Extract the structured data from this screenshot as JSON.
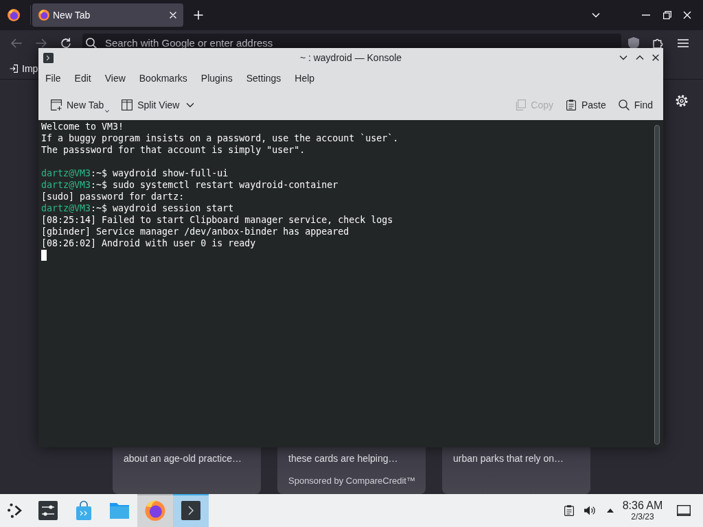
{
  "browser": {
    "tabs": [
      {
        "title": "New Tab",
        "selected": true
      }
    ],
    "nav_buttons": [
      {
        "kind": "back",
        "disabled": true
      },
      {
        "kind": "forward",
        "disabled": true
      },
      {
        "kind": "reload",
        "disabled": false
      }
    ],
    "address_bar": {
      "placeholder": "Search with Google or enter address"
    },
    "bookmarks": [
      {
        "label": "Imp"
      }
    ],
    "cards": [
      {
        "excerpt": "about an age-old practice…"
      },
      {
        "excerpt": "these cards are helping…",
        "sponsor": "Sponsored by CompareCredit™"
      },
      {
        "excerpt": "urban parks that rely on…"
      }
    ]
  },
  "konsole": {
    "title": "~ : waydroid — Konsole",
    "menu": [
      "File",
      "Edit",
      "View",
      "Bookmarks",
      "Plugins",
      "Settings",
      "Help"
    ],
    "toolbar": {
      "left": [
        {
          "kind": "new-tab",
          "label": "New Tab",
          "disabled": false,
          "dropdown": true
        },
        {
          "kind": "split-view",
          "label": "Split View",
          "disabled": false,
          "dropdown": true
        }
      ],
      "right": [
        {
          "kind": "copy",
          "label": "Copy",
          "disabled": true,
          "dropdown": false
        },
        {
          "kind": "paste",
          "label": "Paste",
          "disabled": false,
          "dropdown": false
        },
        {
          "kind": "find",
          "label": "Find",
          "disabled": false,
          "dropdown": false
        }
      ]
    },
    "lines": [
      {
        "kind": "output",
        "text": "Welcome to VM3!"
      },
      {
        "kind": "output",
        "text": "If a buggy program insists on a password, use the account `user`."
      },
      {
        "kind": "output",
        "text": "The passsword for that account is simply \"user\"."
      },
      {
        "kind": "blank"
      },
      {
        "kind": "prompt",
        "user": "dartz@VM3",
        "dir": ":~$",
        "command": "waydroid show-full-ui"
      },
      {
        "kind": "prompt",
        "user": "dartz@VM3",
        "dir": ":~$",
        "command": "sudo systemctl restart waydroid-container"
      },
      {
        "kind": "output",
        "text": "[sudo] password for dartz:"
      },
      {
        "kind": "prompt",
        "user": "dartz@VM3",
        "dir": ":~$",
        "command": "waydroid session start"
      },
      {
        "kind": "output",
        "text": "[08:25:14] Failed to start Clipboard manager service, check logs"
      },
      {
        "kind": "output",
        "text": "[gbinder] Service manager /dev/anbox-binder has appeared"
      },
      {
        "kind": "output",
        "text": "[08:26:02] Android with user 0 is ready"
      },
      {
        "kind": "cursor"
      }
    ]
  },
  "taskbar": {
    "tasks": [
      {
        "kind": "launcher",
        "open": false,
        "selected": false
      },
      {
        "kind": "settings",
        "open": false,
        "selected": false
      },
      {
        "kind": "store",
        "open": false,
        "selected": false
      },
      {
        "kind": "files",
        "open": false,
        "selected": false
      },
      {
        "kind": "browser",
        "open": true,
        "selected": false
      },
      {
        "kind": "terminal",
        "open": true,
        "selected": true
      }
    ],
    "clock": {
      "time": "8:36 AM",
      "date": "2/3/23"
    }
  }
}
